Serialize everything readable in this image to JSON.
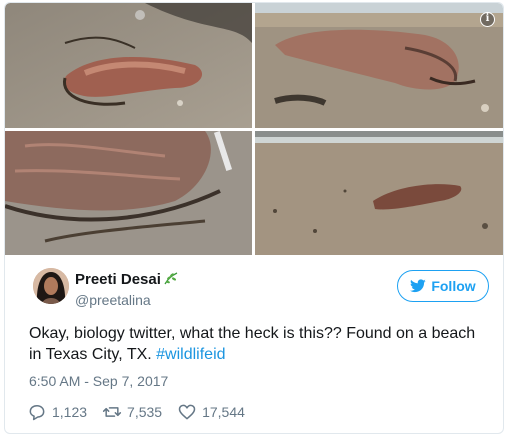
{
  "tweet": {
    "author": {
      "display_name": "Preeti Desai",
      "handle": "@preetalina",
      "badge_icon": "leaf-icon"
    },
    "follow_label": "Follow",
    "text_main": "Okay, biology twitter, what the heck is this?? Found on a beach in Texas City, TX. ",
    "hashtag": "#wildlifeid",
    "timestamp": "6:50 AM - Sep 7, 2017",
    "stats": {
      "replies": "1,123",
      "retweets": "7,535",
      "likes": "17,544"
    },
    "media": [
      {
        "name": "photo-1",
        "icon": "image"
      },
      {
        "name": "photo-2",
        "icon": "image"
      },
      {
        "name": "photo-3",
        "icon": "image"
      },
      {
        "name": "photo-4",
        "icon": "image"
      }
    ]
  },
  "colors": {
    "accent": "#1da1f2",
    "hashtag": "#1b95e0",
    "muted": "#657786",
    "border": "#e1e8ed",
    "text": "#14171a"
  }
}
